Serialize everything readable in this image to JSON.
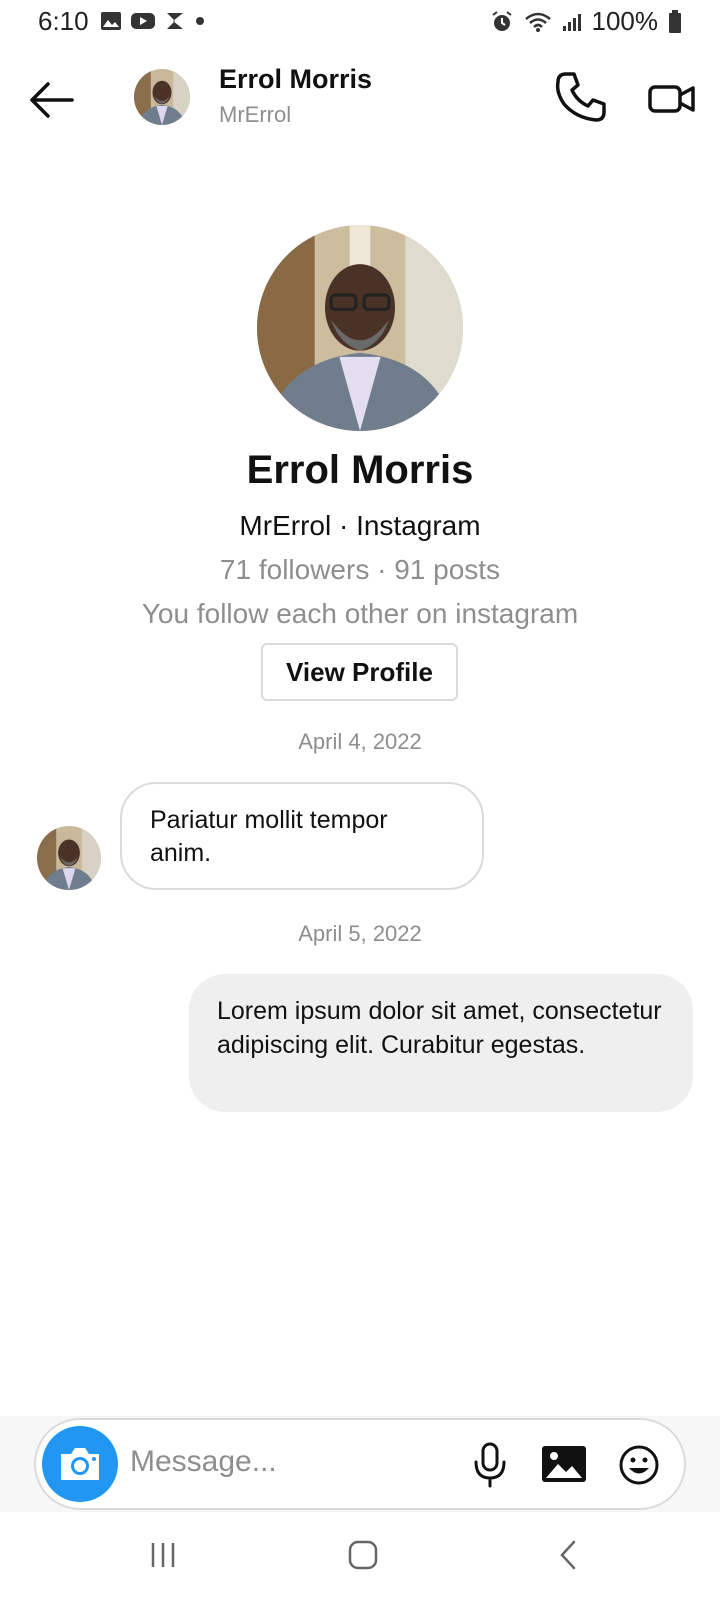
{
  "status_bar": {
    "time": "6:10",
    "battery": "100%",
    "left_icons": [
      "gallery-icon",
      "youtube-icon",
      "app-icon",
      "dot-icon"
    ],
    "right_icons": [
      "alarm-icon",
      "wifi-icon",
      "signal-icon",
      "battery-icon"
    ]
  },
  "header": {
    "name": "Errol Morris",
    "username": "MrErrol"
  },
  "profile": {
    "name": "Errol Morris",
    "subtitle": "MrErrol · Instagram",
    "stats": "71 followers · 91 posts",
    "relation": "You follow each other on instagram",
    "view_profile_label": "View Profile"
  },
  "messages": [
    {
      "date": "April 4, 2022",
      "direction": "incoming",
      "text": "Pariatur mollit tempor anim."
    },
    {
      "date": "April 5, 2022",
      "direction": "outgoing",
      "text": "Lorem ipsum dolor sit amet, consectetur adipiscing elit. Curabitur egestas."
    }
  ],
  "composer": {
    "placeholder": "Message...",
    "value": ""
  },
  "colors": {
    "accent": "#2196f3",
    "muted_text": "#8e8e8e",
    "outgoing_bubble": "#efefef",
    "border": "#dbdbdb"
  }
}
